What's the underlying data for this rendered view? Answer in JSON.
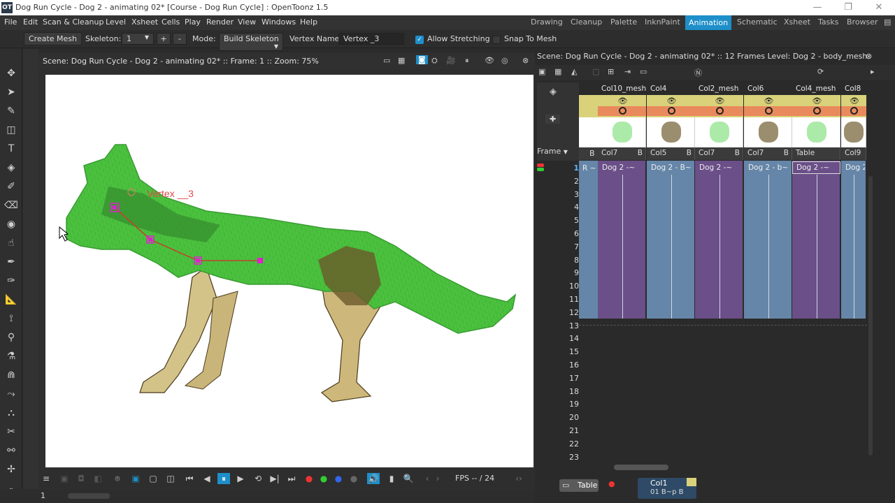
{
  "window": {
    "logo_text": "OT",
    "title": "Dog Run Cycle - Dog 2 - animating 02* [Course - Dog Run Cycle] : OpenToonz 1.5",
    "controls": [
      "—",
      "❐",
      "✕"
    ]
  },
  "menu": {
    "items": [
      "File",
      "Edit",
      "Scan & Cleanup",
      "Level",
      "Xsheet",
      "Cells",
      "Play",
      "Render",
      "View",
      "Windows",
      "Help"
    ],
    "rooms": [
      "Drawing",
      "Cleanup",
      "Palette",
      "InknPaint",
      "Animation",
      "Schematic",
      "Xsheet",
      "Tasks",
      "Browser"
    ],
    "active_room": "Animation"
  },
  "tool_options": {
    "create_mesh": "Create Mesh",
    "skeleton_label": "Skeleton:",
    "skeleton_value": "1",
    "plus": "+",
    "minus": "-",
    "mode_label": "Mode:",
    "mode_value": "Build Skeleton",
    "vertex_name_label": "Vertex Name:",
    "vertex_name_value": "Vertex _3",
    "allow_stretching": "Allow Stretching",
    "allow_stretching_checked": true,
    "snap_to_mesh": "Snap To Mesh",
    "snap_to_mesh_checked": false
  },
  "viewer": {
    "title": "Scene: Dog Run Cycle - Dog 2 - animating 02*  ::  Frame: 1  ::  Zoom: 75%",
    "vertex_label": "Vertex __3",
    "fps_label": "FPS -- / 24"
  },
  "xsheet": {
    "title": "Scene: Dog Run Cycle - Dog 2 - animating 02*  ::  12 Frames  Level: Dog 2 - body_mesh",
    "frame_label": "Frame",
    "columns": [
      {
        "name": "Col10_mesh",
        "sub": "Col7",
        "flag": "B",
        "cell": "Dog 2 -~",
        "color": "#6a4f88"
      },
      {
        "name": "Col4",
        "sub": "Col5",
        "flag": "B",
        "cell": "Dog 2 - B~",
        "color": "#6586a8"
      },
      {
        "name": "Col2_mesh",
        "sub": "Col7",
        "flag": "B",
        "cell": "Dog 2 -~",
        "color": "#6a4f88"
      },
      {
        "name": "Col6",
        "sub": "Col7",
        "flag": "B",
        "cell": "Dog 2 - b~",
        "color": "#6586a8"
      },
      {
        "name": "Col4_mesh",
        "sub": "Table",
        "flag": "",
        "cell": "Dog 2 -~",
        "color": "#6a4f88"
      },
      {
        "name": "Col8",
        "sub": "Col9",
        "flag": "",
        "cell": "Dog 2",
        "color": "#6586a8"
      }
    ],
    "partial_col_cell": "R ~",
    "partial_col_flag": "B",
    "frames": [
      "1",
      "2",
      "3",
      "4",
      "5",
      "6",
      "7",
      "8",
      "9",
      "10",
      "11",
      "12",
      "13",
      "14",
      "15",
      "16",
      "17",
      "18",
      "19",
      "20",
      "21",
      "22",
      "23"
    ],
    "active_frame": "1"
  },
  "schematic": {
    "table_label": "Table",
    "col_label": "Col1",
    "col_sub": "01 B~p B"
  },
  "status": {
    "frame_field": "1"
  },
  "colors": {
    "accent": "#1e8fc9",
    "mesh_green": "#3fc23a",
    "skeleton_magenta": "#e020d0",
    "mesh_column": "#6a4f88",
    "level_column": "#6586a8",
    "header_yellow": "#d9d27a",
    "header_orange": "#e98a5c"
  }
}
